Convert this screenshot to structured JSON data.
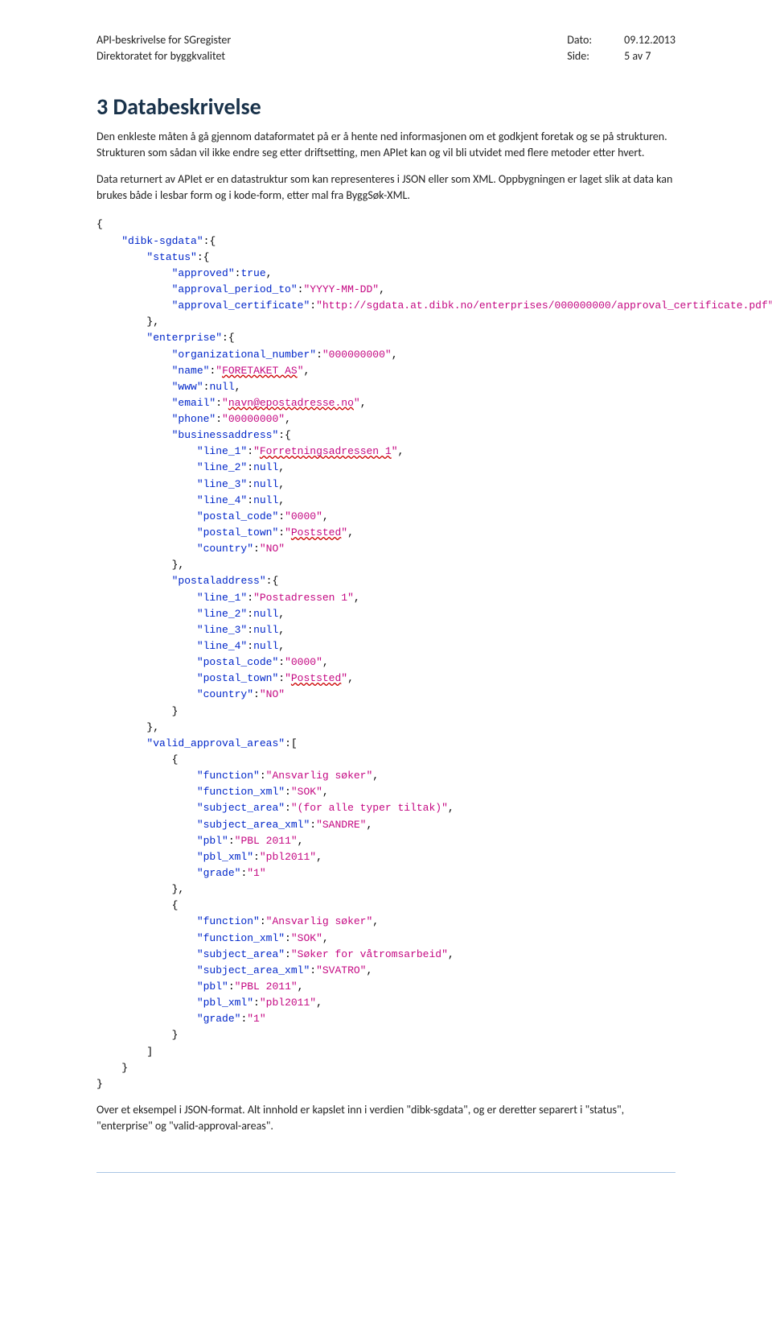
{
  "header": {
    "left_line1": "API-beskrivelse for SGregister",
    "left_line2": "Direktoratet for byggkvalitet",
    "right": {
      "dato_label": "Dato:",
      "dato_value": "09.12.2013",
      "side_label": "Side:",
      "side_value": "5 av 7"
    }
  },
  "section": {
    "title": "3  Databeskrivelse",
    "p1": "Den enkleste måten å gå gjennom dataformatet på er å hente ned informasjonen om et godkjent foretak og se på strukturen. Strukturen som sådan vil ikke endre seg etter driftsetting, men APIet kan og vil bli utvidet med flere metoder etter hvert.",
    "p2": "Data returnert av APIet er en datastruktur som kan representeres i JSON eller som XML. Oppbygningen er laget slik at data kan brukes både i lesbar form og i kode-form, etter mal fra ByggSøk-XML.",
    "p3": "Over et eksempel i JSON-format. Alt innhold er kapslet inn i verdien \"dibk-sgdata\", og er deretter separert i \"status\", \"enterprise\" og \"valid-approval-areas\"."
  },
  "code": {
    "k_dibk": "\"dibk-sgdata\"",
    "k_status": "\"status\"",
    "k_approved": "\"approved\"",
    "v_true": "true",
    "k_apt": "\"approval_period_to\"",
    "v_apt": "\"YYYY-MM-DD\"",
    "k_ac": "\"approval_certificate\"",
    "v_ac": "\"http://sgdata.at.dibk.no/enterprises/000000000/approval_certificate.pdf\"",
    "k_enterprise": "\"enterprise\"",
    "k_orgnum": "\"organizational_number\"",
    "v_orgnum": "\"000000000\"",
    "k_name": "\"name\"",
    "v_name_pre": "\"",
    "v_name_mid": "FORETAKET AS",
    "v_name_suf": "\"",
    "k_www": "\"www\"",
    "v_null": "null",
    "k_email": "\"email\"",
    "v_email_pre": "\"",
    "v_email_mid": "navn@epostadresse.no",
    "v_email_suf": "\"",
    "k_phone": "\"phone\"",
    "v_phone": "\"00000000\"",
    "k_ba": "\"businessaddress\"",
    "k_l1": "\"line_1\"",
    "v_ba_l1_pre": "\"",
    "v_ba_l1_mid": "Forretningsadressen 1",
    "v_ba_l1_suf": "\"",
    "k_l2": "\"line_2\"",
    "k_l3": "\"line_3\"",
    "k_l4": "\"line_4\"",
    "k_pc": "\"postal_code\"",
    "v_pc": "\"0000\"",
    "k_pt": "\"postal_town\"",
    "v_pt_pre": "\"",
    "v_pt_mid": "Poststed",
    "v_pt_suf": "\"",
    "k_country": "\"country\"",
    "v_no": "\"NO\"",
    "k_pa": "\"postaladdress\"",
    "v_pa_l1": "\"Postadressen 1\"",
    "k_vaa": "\"valid_approval_areas\"",
    "k_func": "\"function\"",
    "v_func": "\"Ansvarlig søker\"",
    "k_funcx": "\"function_xml\"",
    "v_funcx": "\"SOK\"",
    "k_sa": "\"subject_area\"",
    "v_sa1": "\"(for alle typer tiltak)\"",
    "k_sax": "\"subject_area_xml\"",
    "v_sandre": "\"SANDRE\"",
    "k_pbl": "\"pbl\"",
    "v_pbl": "\"PBL 2011\"",
    "k_pblx": "\"pbl_xml\"",
    "v_pblx": "\"pbl2011\"",
    "k_grade": "\"grade\"",
    "v_grade": "\"1\"",
    "v_sa2": "\"Søker for våtromsarbeid\"",
    "v_svatro": "\"SVATRO\""
  }
}
